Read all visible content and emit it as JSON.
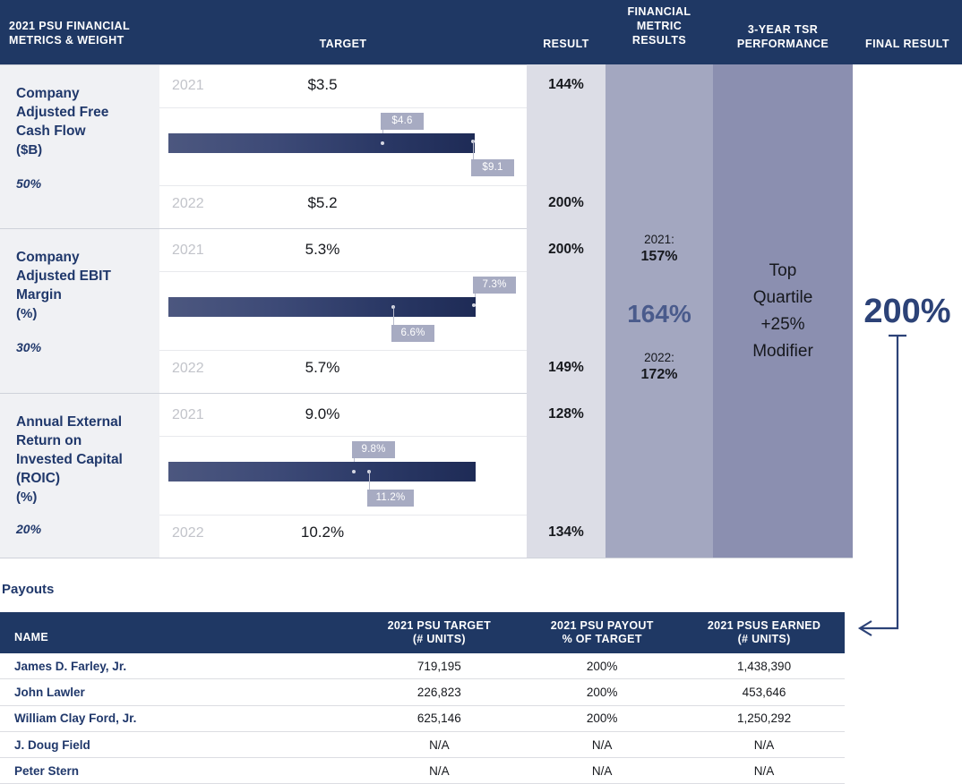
{
  "header": {
    "columns": [
      {
        "id": "metrics",
        "label": "2021 PSU FINANCIAL\nMETRICS & WEIGHT",
        "line1": "2021 PSU FINANCIAL",
        "line2": "METRICS & WEIGHT"
      },
      {
        "id": "target",
        "label": "TARGET"
      },
      {
        "id": "result",
        "label": "RESULT"
      },
      {
        "id": "fmr",
        "line1": "FINANCIAL",
        "line2": "METRIC",
        "line3": "RESULTS"
      },
      {
        "id": "tsr",
        "line1": "3-YEAR TSR",
        "line2": "PERFORMANCE"
      },
      {
        "id": "final",
        "label": "FINAL RESULT"
      }
    ]
  },
  "metrics": [
    {
      "name_lines": [
        "Company",
        "Adjusted Free",
        "Cash Flow"
      ],
      "unit": "($B)",
      "weight": "50%",
      "rows": [
        {
          "year": "2021",
          "target": "$3.5",
          "result": "144%"
        },
        {
          "year": "2022",
          "target": "$5.2",
          "result": "200%"
        }
      ],
      "bar": {
        "markers": [
          {
            "label": "$4.6",
            "position": "above"
          },
          {
            "label": "$9.1",
            "position": "below"
          }
        ]
      }
    },
    {
      "name_lines": [
        "Company",
        "Adjusted EBIT",
        "Margin"
      ],
      "unit": "(%)",
      "weight": "30%",
      "rows": [
        {
          "year": "2021",
          "target": "5.3%",
          "result": "200%"
        },
        {
          "year": "2022",
          "target": "5.7%",
          "result": "149%"
        }
      ],
      "bar": {
        "markers": [
          {
            "label": "7.3%",
            "position": "above"
          },
          {
            "label": "6.6%",
            "position": "below"
          }
        ]
      }
    },
    {
      "name_lines": [
        "Annual External",
        "Return on",
        "Invested Capital",
        "(ROIC)"
      ],
      "unit": "(%)",
      "weight": "20%",
      "rows": [
        {
          "year": "2021",
          "target": "9.0%",
          "result": "128%"
        },
        {
          "year": "2022",
          "target": "10.2%",
          "result": "134%"
        }
      ],
      "bar": {
        "markers": [
          {
            "label": "9.8%",
            "position": "above"
          },
          {
            "label": "11.2%",
            "position": "below"
          }
        ]
      }
    }
  ],
  "financial_metric_results": {
    "y2021_caption": "2021:",
    "y2021_value": "157%",
    "combined_value": "164%",
    "y2022_caption": "2022:",
    "y2022_value": "172%"
  },
  "tsr_performance": {
    "line1": "Top",
    "line2": "Quartile",
    "line3": "+25%",
    "line4": "Modifier"
  },
  "final_result": {
    "value": "200%"
  },
  "payouts": {
    "section_title": "Payouts",
    "columns": [
      {
        "line1": "NAME",
        "line2": ""
      },
      {
        "line1": "2021 PSU TARGET",
        "line2": "(# UNITS)"
      },
      {
        "line1": "2021 PSU PAYOUT",
        "line2": "% OF TARGET"
      },
      {
        "line1": "2021 PSUS EARNED",
        "line2": "(# UNITS)"
      }
    ],
    "rows": [
      {
        "name": "James D. Farley, Jr.",
        "target": "719,195",
        "payout_pct": "200%",
        "earned": "1,438,390"
      },
      {
        "name": "John Lawler",
        "target": "226,823",
        "payout_pct": "200%",
        "earned": "453,646"
      },
      {
        "name": "William Clay Ford, Jr.",
        "target": "625,146",
        "payout_pct": "200%",
        "earned": "1,250,292"
      },
      {
        "name": "J. Doug Field",
        "target": "N/A",
        "payout_pct": "N/A",
        "earned": "N/A"
      },
      {
        "name": "Peter Stern",
        "target": "N/A",
        "payout_pct": "N/A",
        "earned": "N/A"
      }
    ]
  },
  "colors": {
    "header_navy": "#1f3864",
    "metric_label_blue": "#20386b",
    "result_col_bg": "#dcdde6",
    "fmr_col_bg": "#a3a7c0",
    "tsr_col_bg": "#8b8fb0",
    "bar_gradient_start": "#4c577f",
    "bar_gradient_end": "#1e2b56",
    "callout_bg": "#a7abc2",
    "accent_blue": "#2c4277"
  },
  "chart_data": {
    "type": "bar",
    "title": "2021 PSU Financial Metrics & Weight",
    "series": [
      {
        "name": "Company Adjusted Free Cash Flow ($B)",
        "weight": "50%",
        "targets": [
          {
            "year": "2021",
            "target": 3.5,
            "result_pct": 144
          },
          {
            "year": "2022",
            "target": 5.2,
            "result_pct": 200
          }
        ],
        "actuals": [
          {
            "label": "$4.6",
            "value": 4.6
          },
          {
            "label": "$9.1",
            "value": 9.1
          }
        ]
      },
      {
        "name": "Company Adjusted EBIT Margin (%)",
        "weight": "30%",
        "targets": [
          {
            "year": "2021",
            "target": 5.3,
            "result_pct": 200
          },
          {
            "year": "2022",
            "target": 5.7,
            "result_pct": 149
          }
        ],
        "actuals": [
          {
            "label": "7.3%",
            "value": 7.3
          },
          {
            "label": "6.6%",
            "value": 6.6
          }
        ]
      },
      {
        "name": "Annual External Return on Invested Capital (ROIC) (%)",
        "weight": "20%",
        "targets": [
          {
            "year": "2021",
            "target": 9.0,
            "result_pct": 128
          },
          {
            "year": "2022",
            "target": 10.2,
            "result_pct": 134
          }
        ],
        "actuals": [
          {
            "label": "9.8%",
            "value": 9.8
          },
          {
            "label": "11.2%",
            "value": 11.2
          }
        ]
      }
    ],
    "financial_metric_results": {
      "2021": 157,
      "2022": 172,
      "combined": 164
    },
    "tsr_performance": "Top Quartile +25% Modifier",
    "final_result_pct": 200
  }
}
